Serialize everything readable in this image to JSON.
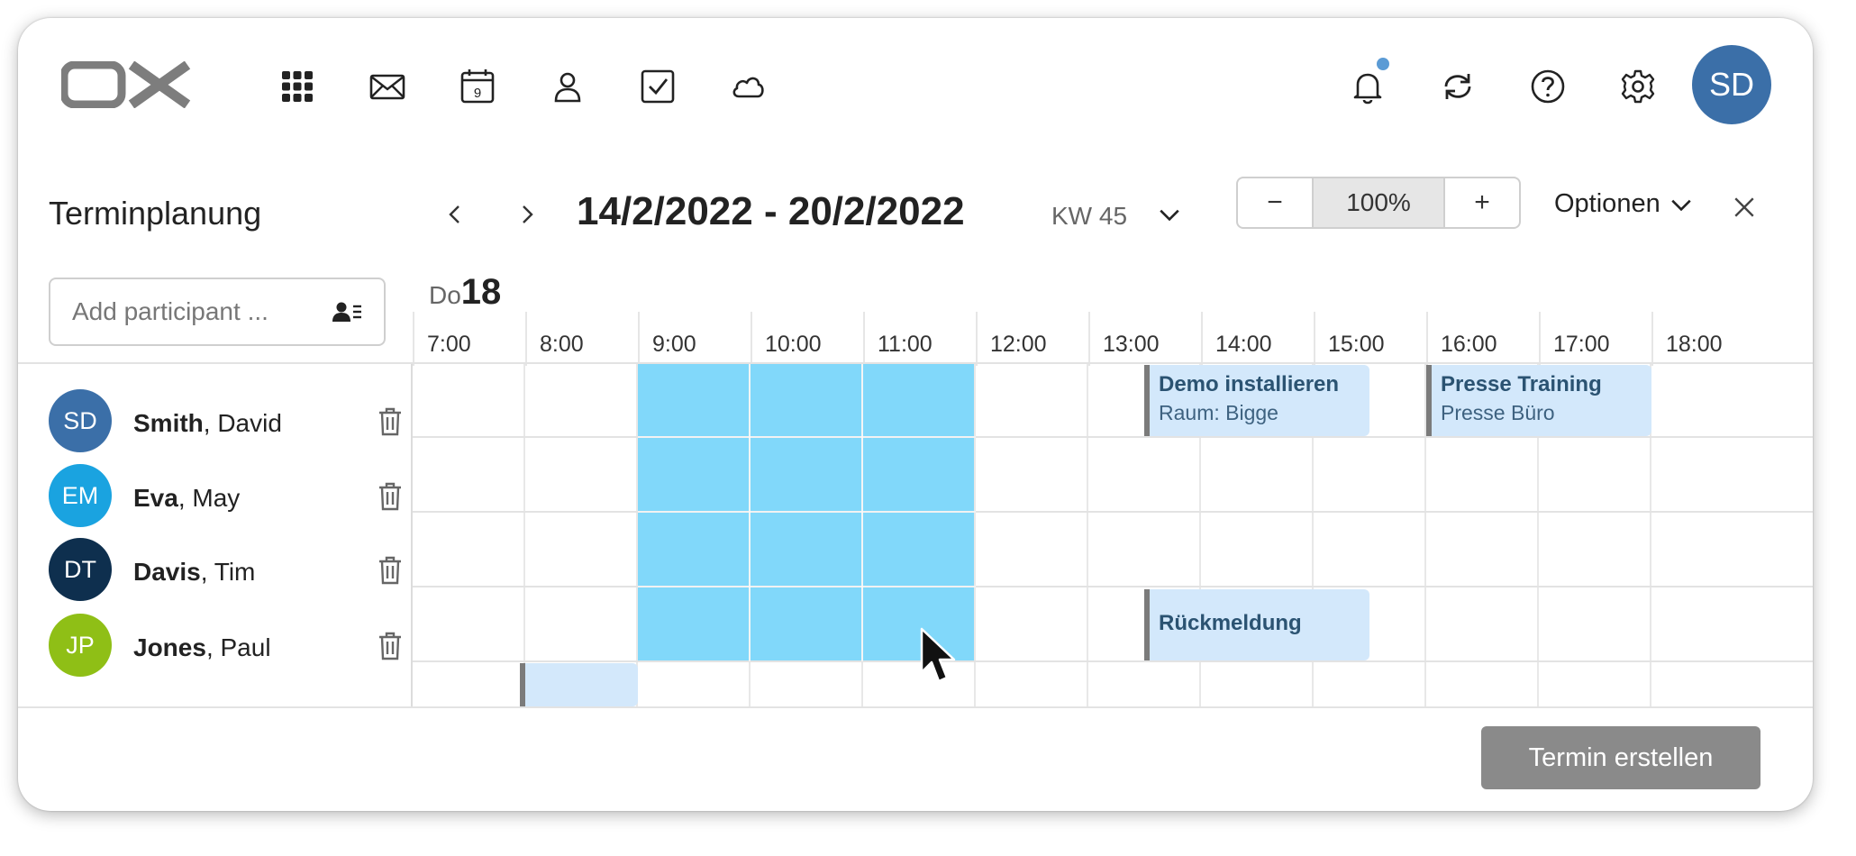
{
  "app": {
    "logo_text": "OX",
    "user_initials": "SD",
    "user_avatar_color": "#3b6fa8",
    "app_icons": [
      "apps-grid-icon",
      "mail-icon",
      "calendar-icon",
      "contacts-icon",
      "tasks-icon",
      "drive-icon"
    ],
    "calendar_icon_day": "9",
    "right_icons": [
      "bell-icon",
      "refresh-icon",
      "help-icon",
      "gear-icon"
    ]
  },
  "header": {
    "title": "Terminplanung",
    "date_range": "14/2/2022 - 20/2/2022",
    "week": "KW 45",
    "zoom": {
      "minus": "−",
      "value": "100%",
      "plus": "+"
    },
    "options_label": "Optionen"
  },
  "participant_input": {
    "placeholder": "Add participant ..."
  },
  "day": {
    "weekday": "Do",
    "day": "18"
  },
  "hours": [
    "7:00",
    "8:00",
    "9:00",
    "10:00",
    "11:00",
    "12:00",
    "13:00",
    "14:00",
    "15:00",
    "16:00",
    "17:00",
    "18:00"
  ],
  "participants": [
    {
      "initials": "SD",
      "last": "Smith",
      "first": ", David",
      "color": "#3b6fa8"
    },
    {
      "initials": "EM",
      "last": "Eva",
      "first": ", May",
      "color": "#1aa3e0"
    },
    {
      "initials": "DT",
      "last": "Davis",
      "first": ", Tim",
      "color": "#0e2f4e"
    },
    {
      "initials": "JP",
      "last": "Jones",
      "first": ", Paul",
      "color": "#8fbf16"
    }
  ],
  "events": [
    {
      "title": "Demo installieren",
      "subtitle": "Raum: Bigge"
    },
    {
      "title": "Presse Training",
      "subtitle": "Presse Büro"
    },
    {
      "title": "Rückmeldung",
      "subtitle": ""
    }
  ],
  "selection_color": "#81d8fa",
  "event_color": "#d3e8fb",
  "footer": {
    "create_label": "Termin erstellen"
  }
}
